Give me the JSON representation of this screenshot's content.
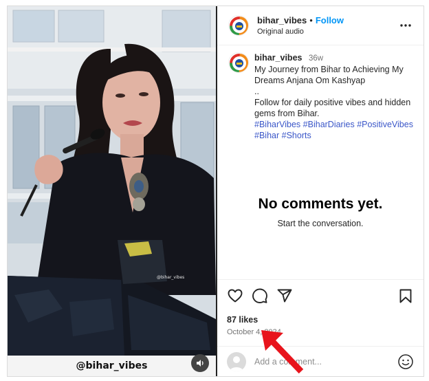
{
  "media": {
    "watermark_small": "@bihar_vibes",
    "caption_overlay": "@bihar_vibes"
  },
  "header": {
    "username": "bihar_vibes",
    "separator": "•",
    "follow_label": "Follow",
    "subtitle": "Original audio",
    "more_icon": "more-options-icon"
  },
  "caption": {
    "username": "bihar_vibes",
    "time": "36w",
    "line1": "My Journey from Bihar to Achieving My Dreams Anjana Om Kashyap",
    "line2": "..",
    "line3": "Follow for daily positive vibes and hidden gems from Bihar.",
    "hashtags": [
      "#BiharVibes",
      "#BiharDiaries",
      "#PositiveVibes",
      "#Bihar",
      "#Shorts"
    ]
  },
  "comments": {
    "empty_title": "No comments yet.",
    "empty_subtitle": "Start the conversation."
  },
  "actions": {
    "icons": [
      "heart-icon",
      "comment-icon",
      "share-icon",
      "bookmark-icon"
    ],
    "likes": "87 likes",
    "date": "October 4, 2024"
  },
  "comment_box": {
    "placeholder": "Add a comment...",
    "emoji_icon": "emoji-icon"
  },
  "colors": {
    "accent": "#0095f6",
    "hashtag": "#3a56c8",
    "annotation_arrow": "#e8141c"
  }
}
